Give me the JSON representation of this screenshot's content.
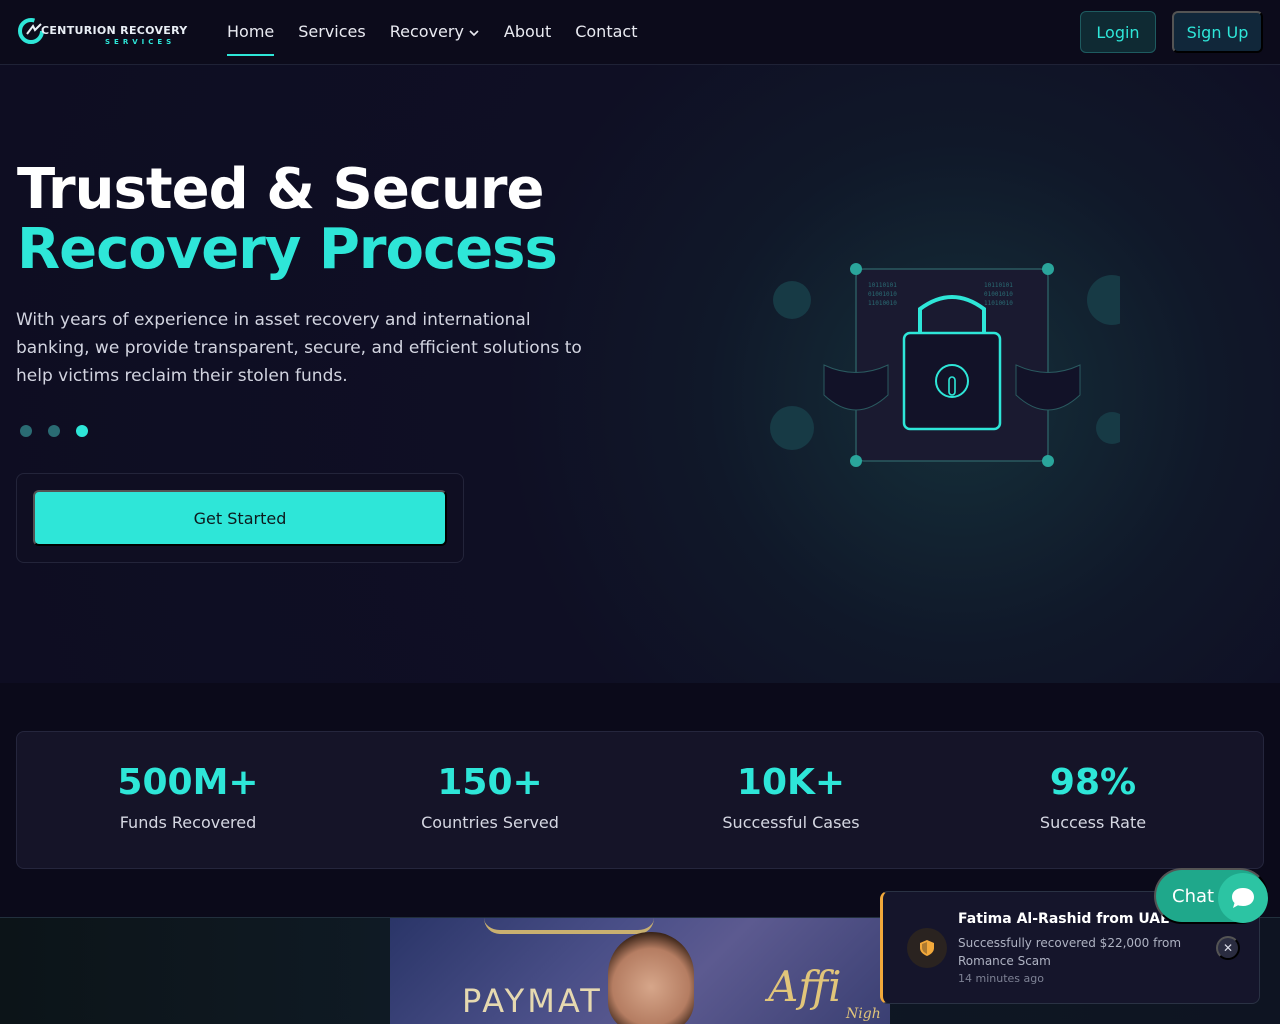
{
  "brand": {
    "name": "CENTURION RECOVERY",
    "sub": "SERVICES",
    "accent": "#2ee6d8"
  },
  "nav": {
    "links": [
      {
        "label": "Home"
      },
      {
        "label": "Services"
      },
      {
        "label": "Recovery"
      },
      {
        "label": "About"
      },
      {
        "label": "Contact"
      }
    ],
    "login": "Login",
    "signup": "Sign Up"
  },
  "hero": {
    "title_line1": "Trusted & Secure",
    "title_line2": "Recovery Process",
    "paragraph": "With years of experience in asset recovery and international banking, we provide transparent, secure, and efficient solutions to help victims reclaim their stolen funds.",
    "cta": "Get Started",
    "lock_binary": [
      "10110101",
      "01001010",
      "11010010",
      "10110101",
      "01001010",
      "11010010"
    ]
  },
  "stats": [
    {
      "value": "500M+",
      "label": "Funds Recovered"
    },
    {
      "value": "150+",
      "label": "Countries Served"
    },
    {
      "value": "10K+",
      "label": "Successful Cases"
    },
    {
      "value": "98%",
      "label": "Success Rate"
    }
  ],
  "photo": {
    "text": "PAYMAT",
    "script": "Affi",
    "script_sub": "Nigh"
  },
  "toast": {
    "name": "Fatima Al-Rashid from UAE",
    "message": "Successfully recovered $22,000 from Romance Scam",
    "time": "14 minutes ago",
    "close": "✕"
  },
  "chat": {
    "label": "Chat"
  }
}
